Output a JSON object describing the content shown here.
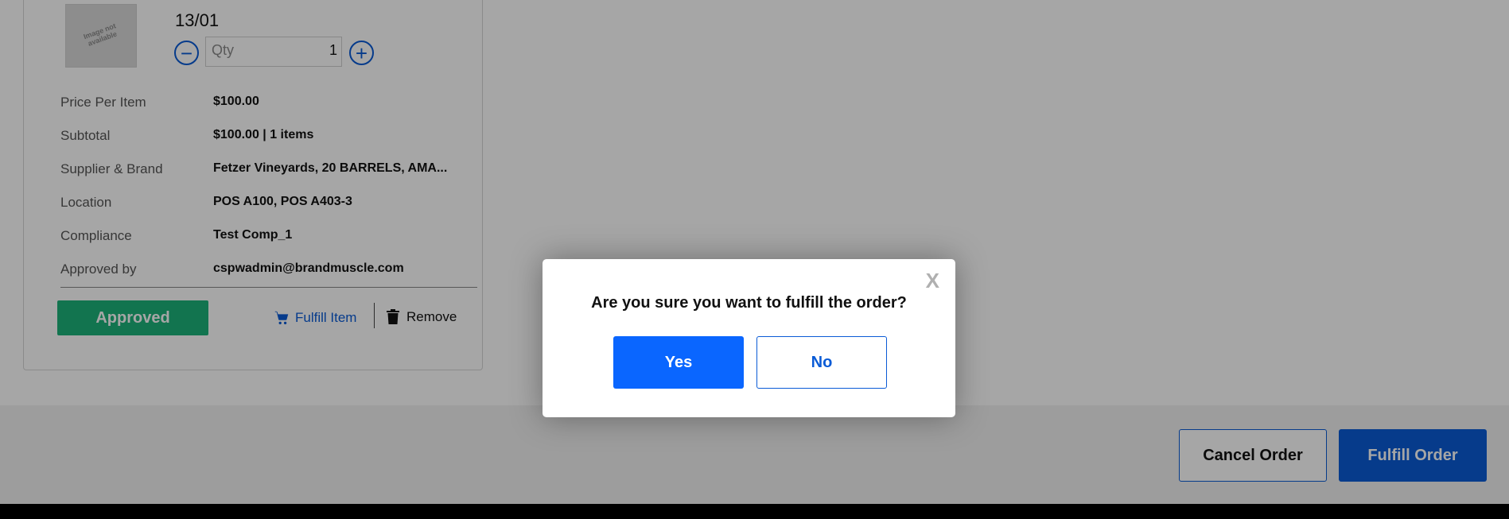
{
  "item": {
    "image_alt": "Image not\navailable",
    "code": "13/01",
    "qty_placeholder": "Qty",
    "qty_value": "1",
    "details": [
      {
        "label": "Price Per Item",
        "value": "$100.00"
      },
      {
        "label": "Subtotal",
        "value": "$100.00 | 1 items"
      },
      {
        "label": "Supplier & Brand",
        "value": "Fetzer Vineyards, 20 BARRELS, AMA..."
      },
      {
        "label": "Location",
        "value": "POS A100, POS A403-3"
      },
      {
        "label": "Compliance",
        "value": "Test Comp_1"
      },
      {
        "label": "Approved by",
        "value": "cspwadmin@brandmuscle.com"
      }
    ],
    "approved_label": "Approved",
    "fulfill_item_label": "Fulfill Item",
    "remove_label": "Remove"
  },
  "footer": {
    "cancel_order_label": "Cancel Order",
    "fulfill_order_label": "Fulfill Order"
  },
  "dialog": {
    "close_label": "X",
    "message": "Are you sure you want to fulfill the order?",
    "yes_label": "Yes",
    "no_label": "No"
  },
  "colors": {
    "primary": "#0a5bd6",
    "approved": "#1db37a",
    "yes_button": "#0a66ff"
  },
  "icons": {
    "minus": "minus-circle-icon",
    "plus": "plus-circle-icon",
    "fulfill_item": "cart-icon",
    "remove": "trash-icon"
  }
}
